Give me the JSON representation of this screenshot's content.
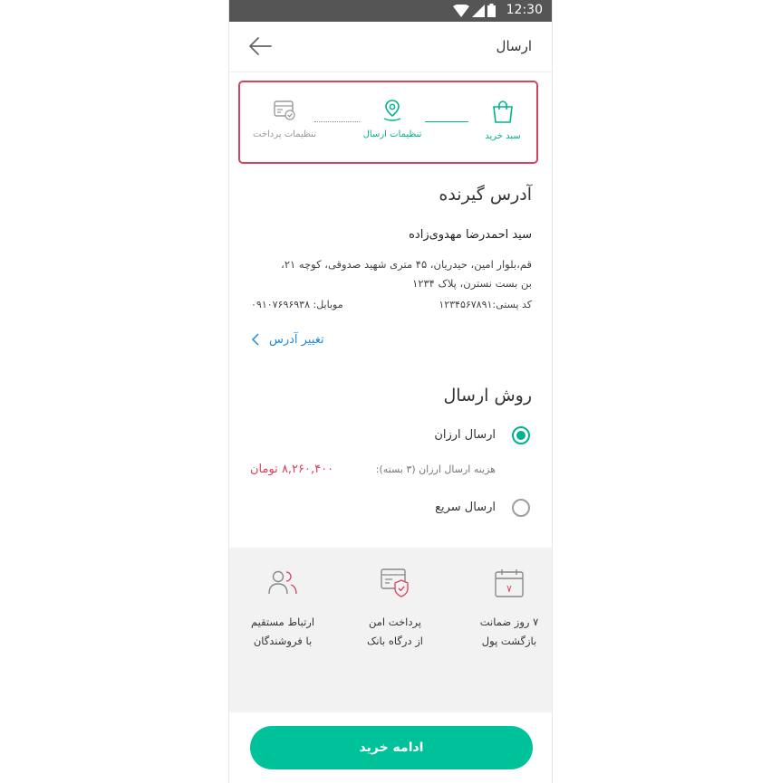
{
  "status": {
    "time": "12:30"
  },
  "appbar": {
    "title": "ارسال"
  },
  "stepper": {
    "steps": [
      {
        "label": "سبد خرید",
        "state": "done"
      },
      {
        "label": "تنظیمات ارسال",
        "state": "active"
      },
      {
        "label": "تنظیمات پرداخت",
        "state": "pending"
      }
    ]
  },
  "address": {
    "heading": "آدرس گیرنده",
    "name": "سید احمدرضا مهدوی‌زاده",
    "line1": "قم،بلوار امین، حیدریان، ۴۵ متری شهید صدوقی، کوچه ۲۱،",
    "line2": "بن بست نسترن، پلاک ۱۲۳۴",
    "postal": "کد پستی:۱۲۳۴۵۶۷۸۹۱",
    "mobile": "موبایل: ۰۹۱۰۷۶۹۶۹۳۸",
    "change_label": "تغییر آدرس"
  },
  "shipping": {
    "heading": "روش ارسال",
    "options": [
      {
        "label": "ارسال ارزان",
        "selected": true
      },
      {
        "label": "ارسال سریع",
        "selected": false
      }
    ],
    "cost_label": "هزینه ارسال ارزان (۳ بسته):",
    "cost_value": "۸,۲۶۰,۴۰۰ تومان"
  },
  "features": [
    {
      "line1": "۷ روز ضمانت",
      "line2": "بازگشت پول",
      "icon": "calendar-icon",
      "badge": "۷"
    },
    {
      "line1": "پرداخت امن",
      "line2": "از درگاه بانک",
      "icon": "secure-payment-icon"
    },
    {
      "line1": "ارتباط مستقیم",
      "line2": "با فروشندگان",
      "icon": "users-icon"
    }
  ],
  "cta": {
    "label": "ادامه خرید"
  },
  "colors": {
    "accent": "#00c29a",
    "highlight": "#d9425c",
    "link": "#1a8be0"
  }
}
